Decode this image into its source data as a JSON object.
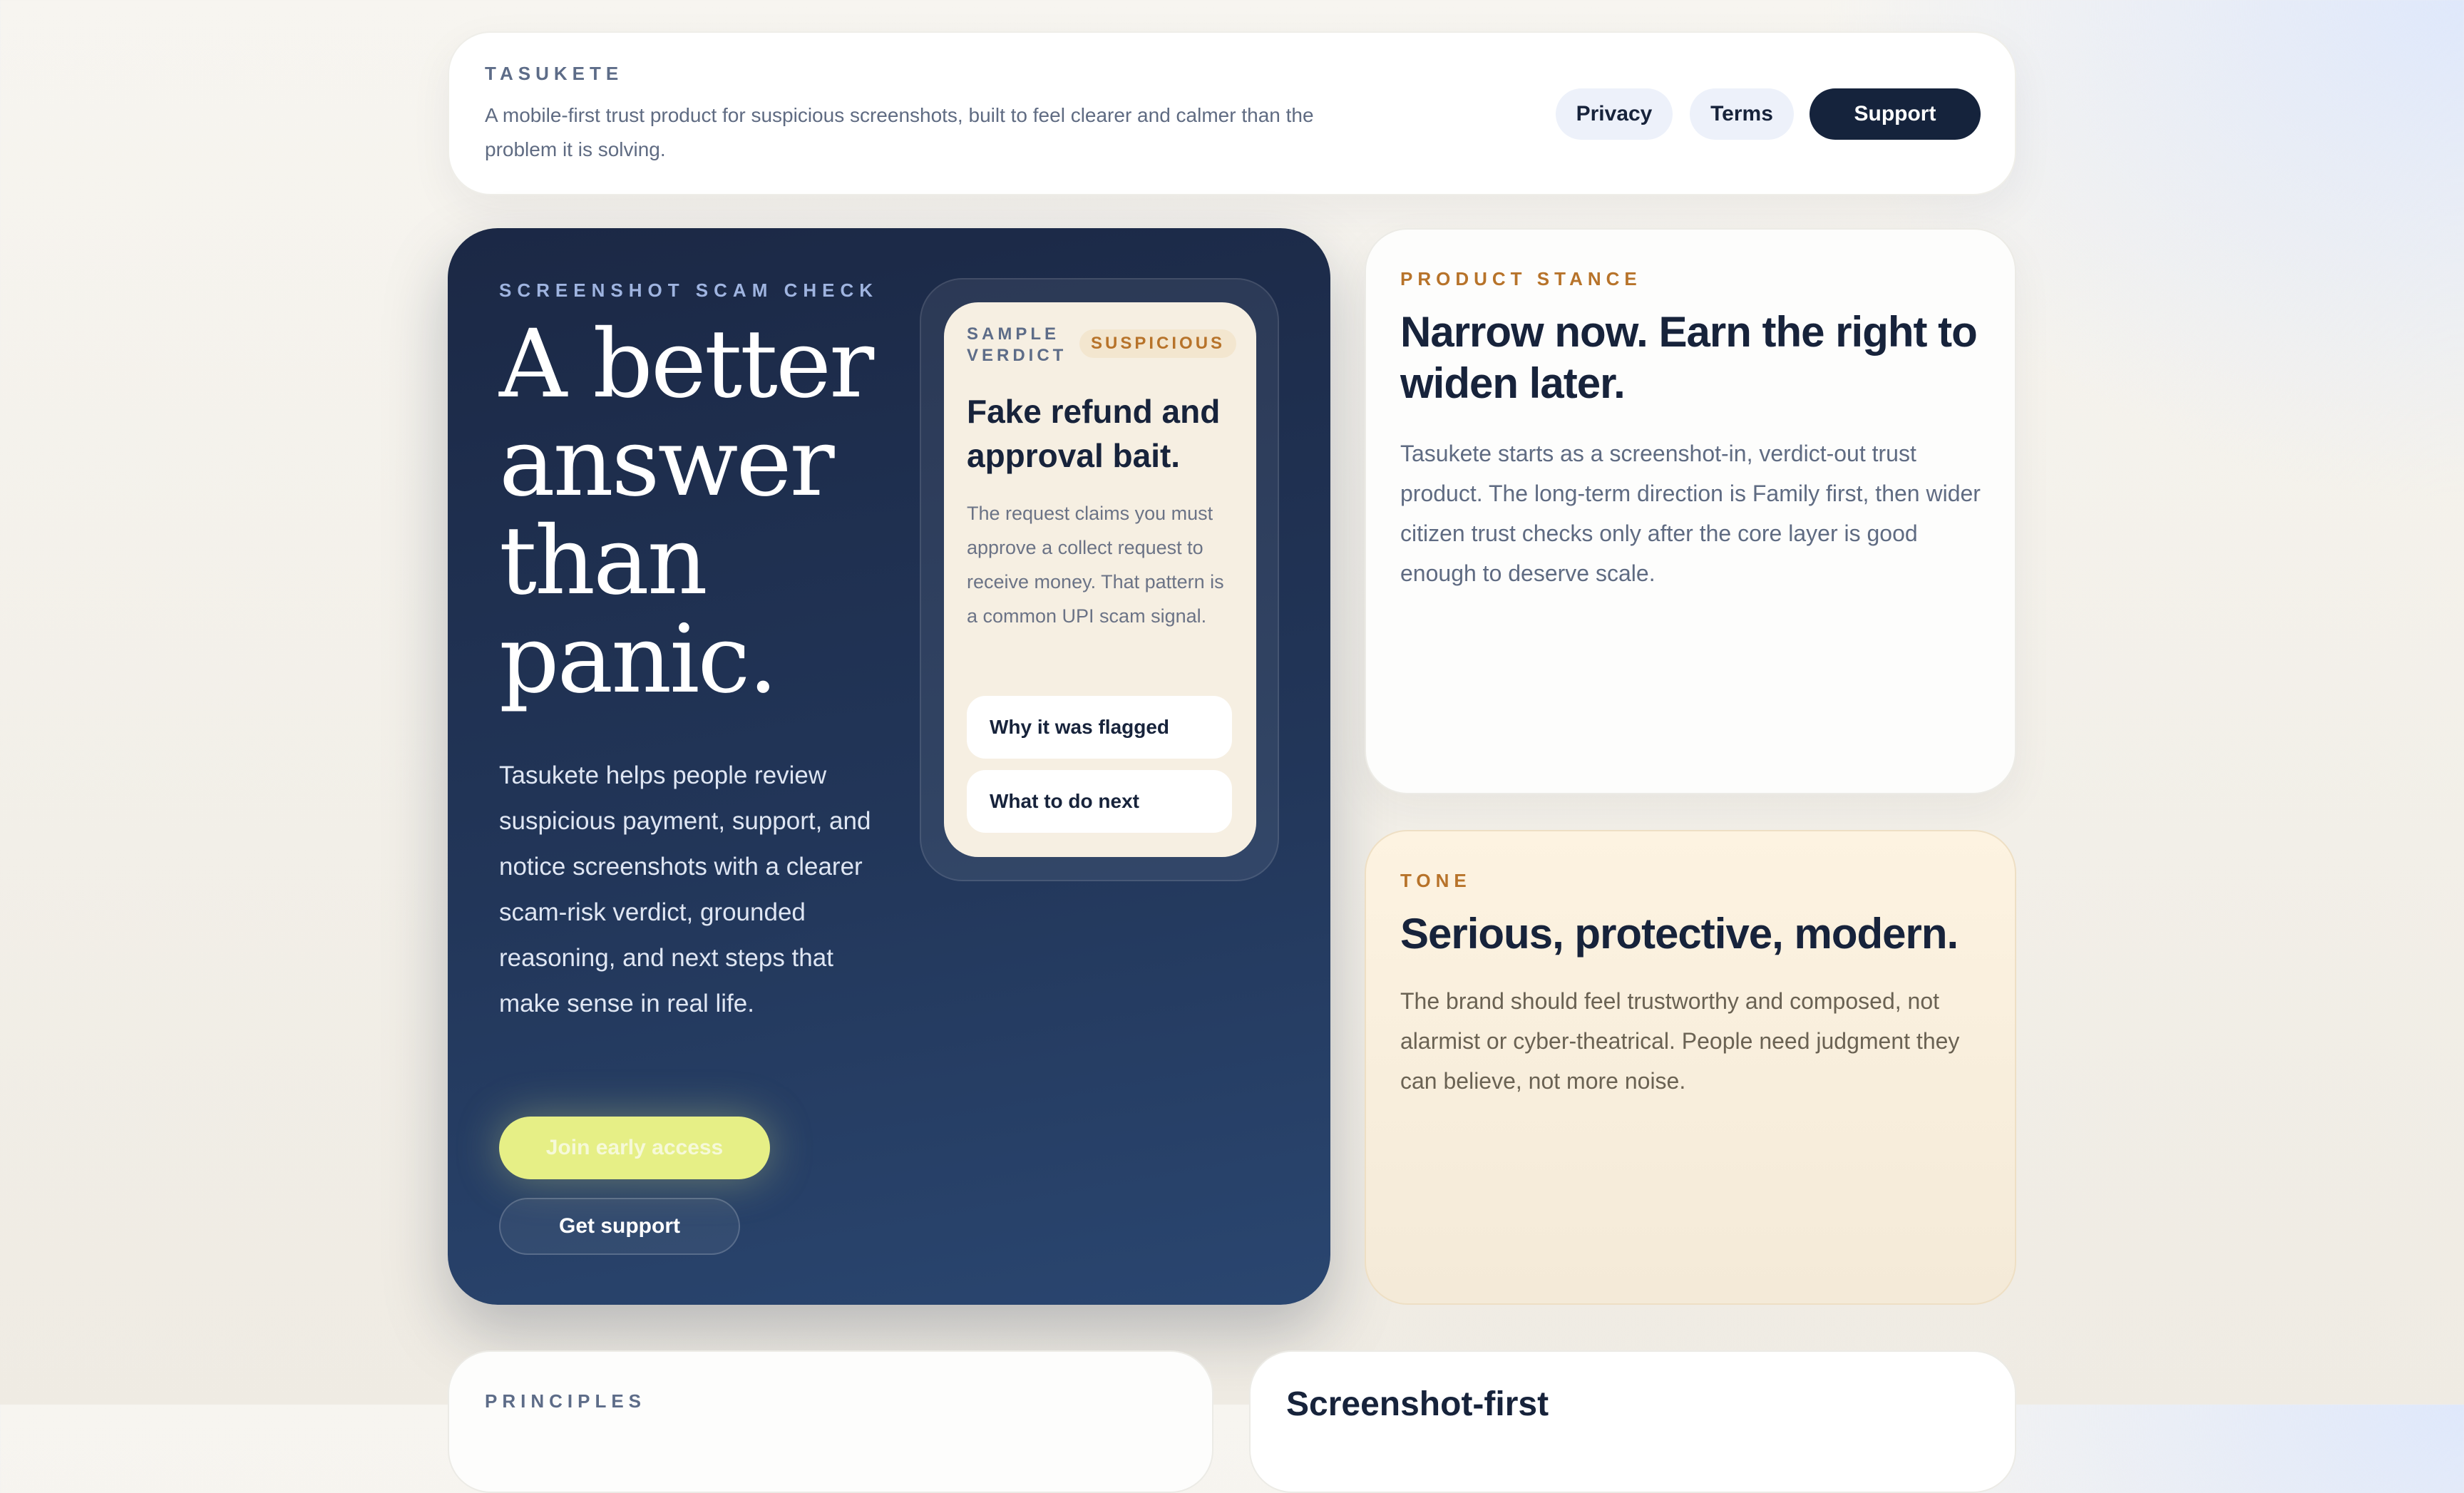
{
  "header": {
    "brand": "TASUKETE",
    "tagline": "A mobile-first trust product for suspicious screenshots, built to feel clearer and calmer than the problem it is solving.",
    "nav": {
      "privacy": "Privacy",
      "terms": "Terms",
      "support": "Support"
    }
  },
  "hero": {
    "eyebrow": "SCREENSHOT SCAM CHECK",
    "title": "A better answer than panic.",
    "description": "Tasukete helps people review suspicious payment, support, and notice screenshots with a clearer scam-risk verdict, grounded reasoning, and next steps that make sense in real life.",
    "cta_primary": "Join early access",
    "cta_secondary": "Get support"
  },
  "sample_card": {
    "label": "SAMPLE VERDICT",
    "badge": "SUSPICIOUS",
    "title": "Fake refund and approval bait.",
    "body": "The request claims you must approve a collect request to receive money. That pattern is a common UPI scam signal.",
    "button_1": "Why it was flagged",
    "button_2": "What to do next"
  },
  "stance": {
    "eyebrow": "PRODUCT STANCE",
    "title": "Narrow now. Earn the right to widen later.",
    "body": "Tasukete starts as a screenshot-in, verdict-out trust product. The long-term direction is Family first, then wider citizen trust checks only after the core layer is good enough to deserve scale."
  },
  "tone": {
    "eyebrow": "TONE",
    "title": "Serious, protective, modern.",
    "body": "The brand should feel trustworthy and composed, not alarmist or cyber-theatrical. People need judgment they can believe, not more noise."
  },
  "bottom": {
    "principles_eyebrow": "PRINCIPLES",
    "right_title": "Screenshot-first"
  },
  "colors": {
    "navy": "#15233c",
    "accent_lime": "#e6ef86",
    "accent_amber": "#b7732a",
    "tone_bg": "#fdf3e1"
  }
}
